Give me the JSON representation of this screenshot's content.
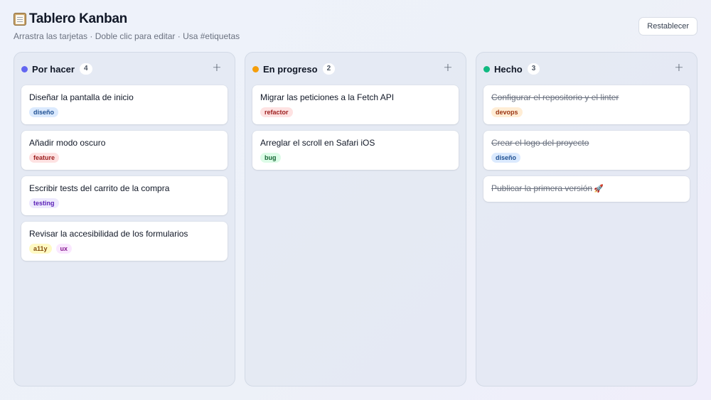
{
  "header": {
    "title": "Tablero Kanban",
    "subtitle": "Arrastra las tarjetas · Doble clic para editar · Usa #etiquetas",
    "reset_label": "Restablecer",
    "icon": "clipboard-icon"
  },
  "columns": [
    {
      "title": "Por hacer",
      "count": "4",
      "dot_color": "#6366f1",
      "add_label": "+",
      "cards": [
        {
          "title": "Diseñar la pantalla de inicio",
          "tags": [
            "diseño"
          ]
        },
        {
          "title": "Añadir modo oscuro",
          "tags": [
            "feature"
          ]
        },
        {
          "title": "Escribir tests del carrito de la compra",
          "tags": [
            "testing"
          ]
        },
        {
          "title": "Revisar la accesibilidad de los formularios",
          "tags": [
            "a11y",
            "ux"
          ]
        }
      ]
    },
    {
      "title": "En progreso",
      "count": "2",
      "dot_color": "#f59e0b",
      "add_label": "+",
      "cards": [
        {
          "title": "Migrar las peticiones a la Fetch API",
          "tags": [
            "refactor"
          ]
        },
        {
          "title": "Arreglar el scroll en Safari iOS",
          "tags": [
            "bug"
          ]
        }
      ]
    },
    {
      "title": "Hecho",
      "count": "3",
      "dot_color": "#10b981",
      "add_label": "+",
      "cards": [
        {
          "title": "Configurar el repositorio y el linter",
          "tags": [
            "devops"
          ]
        },
        {
          "title": "Crear el logo del proyecto",
          "tags": [
            "diseño"
          ]
        },
        {
          "title": "Publicar la primera versión",
          "tags": [],
          "emoji": "🚀"
        }
      ]
    }
  ],
  "tag_colors": {
    "diseño": {
      "bg": "#dbeafe",
      "fg": "#1e4f91"
    },
    "feature": {
      "bg": "#fee2e2",
      "fg": "#9b1c1c"
    },
    "testing": {
      "bg": "#ede9fe",
      "fg": "#5b21b6"
    },
    "a11y": {
      "bg": "#fef9c3",
      "fg": "#854d0e"
    },
    "ux": {
      "bg": "#fae8ff",
      "fg": "#86198f"
    },
    "refactor": {
      "bg": "#fee2e2",
      "fg": "#9b1c1c"
    },
    "bug": {
      "bg": "#dcfce7",
      "fg": "#166534"
    },
    "devops": {
      "bg": "#ffedd5",
      "fg": "#9a3412"
    }
  }
}
